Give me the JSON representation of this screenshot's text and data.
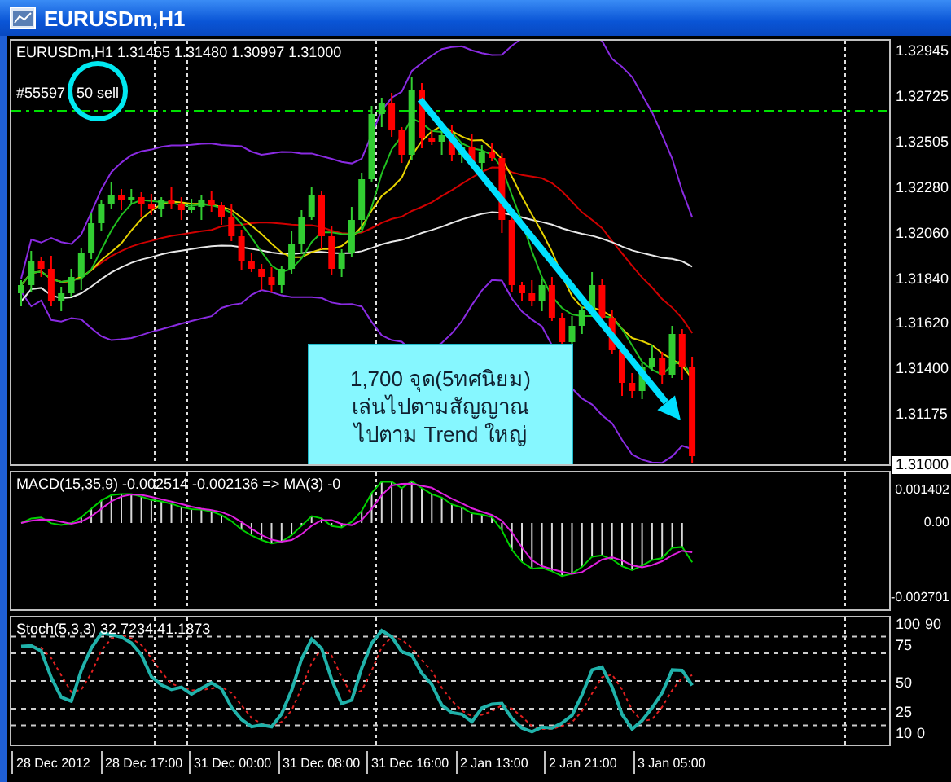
{
  "window": {
    "title": "EURUSDm,H1"
  },
  "main_pane": {
    "header": "EURUSDm,H1 1.31465 1.31480 1.30997 1.31000",
    "order": {
      "number": "#55597",
      "label": "50 sell"
    },
    "price_axis": [
      "1.32945",
      "1.32725",
      "1.32505",
      "1.32280",
      "1.32060",
      "1.31840",
      "1.31620",
      "1.31400",
      "1.31175"
    ],
    "current_price": "1.31000",
    "callout": {
      "text": "1,700 จุด(5ทศนิยม)\nเล่นไปตามสัญญาณ\nไปตาม Trend ใหญ่"
    }
  },
  "macd_pane": {
    "header": "MACD(15,35,9) -0.002514 -0.002136 => MA(3) -0",
    "axis": [
      "0.001402",
      "0.00",
      "-0.002701"
    ]
  },
  "stoch_pane": {
    "header": "Stoch(5,3,3) 32.7234 41.1873",
    "axis_rows": [
      [
        "100",
        "90"
      ],
      [
        "75"
      ],
      [
        "50"
      ],
      [
        "25"
      ],
      [
        "10",
        "0"
      ]
    ]
  },
  "time_axis": [
    "28 Dec 2012",
    "28 Dec 17:00",
    "31 Dec 00:00",
    "31 Dec 08:00",
    "31 Dec 16:00",
    "2 Jan 13:00",
    "2 Jan 21:00",
    "3 Jan 05:00"
  ]
}
